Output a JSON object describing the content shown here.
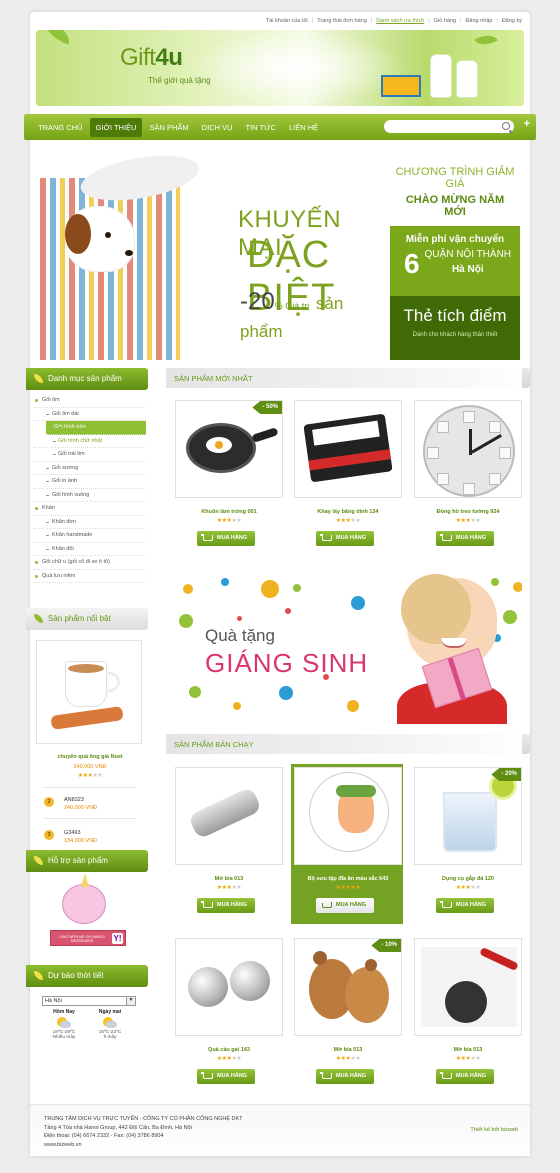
{
  "top_links": [
    "Tài khoản của tôi",
    "Trạng thái đơn hàng",
    "Danh sách ưa thích",
    "Giỏ hàng",
    "Đăng nhập",
    "Đăng ký"
  ],
  "top_links_active_index": 2,
  "logo": {
    "text_main": "Gift",
    "text_bold": "4u",
    "tagline": "Thế giới quà tặng"
  },
  "nav": {
    "items": [
      "TRANG CHỦ",
      "GIỚI THIỆU",
      "SẢN PHẨM",
      "DỊCH VỤ",
      "TIN TỨC",
      "LIÊN HỆ"
    ],
    "active_index": 1,
    "search_placeholder": ""
  },
  "banner": {
    "line1": "KHUYẾN MẠI",
    "line2": "ĐẶC BIỆT",
    "discount": "-20",
    "percent": "%",
    "discount_note": "Giá trị",
    "discount_note2": "sản",
    "discount_note3": "phẩm",
    "right1_line1": "CHƯƠNG TRÌNH GIẢM GIÁ",
    "right1_line2": "CHÀO MỪNG NĂM MỚI",
    "right2_line1": "Miễn phí vận chuyển",
    "right2_six": "6",
    "right2_line2": "QUẬN NỘI THÀNH",
    "right2_line3": "Hà Nội",
    "right3_line1": "Thẻ tích điểm",
    "right3_line2": "Dành cho khách hàng thân thiết"
  },
  "sidebar": {
    "categories_title": "Danh mục sản phẩm",
    "categories": [
      {
        "label": "Gối ôm",
        "level": 0
      },
      {
        "label": "Gối ôm dài",
        "level": 1
      },
      {
        "label": "Gối hình tròn",
        "level": 1,
        "highlight": true
      },
      {
        "label": "Gối hình chữ nhật",
        "level": 2,
        "sub": true
      },
      {
        "label": "Gối trái tim",
        "level": 2
      },
      {
        "label": "Gối sương",
        "level": 1
      },
      {
        "label": "Gối in ảnh",
        "level": 1
      },
      {
        "label": "Gối hình vuông",
        "level": 1
      },
      {
        "label": "Khăn",
        "level": 0
      },
      {
        "label": "Khăn đơn",
        "level": 1
      },
      {
        "label": "Khăn handmade",
        "level": 1
      },
      {
        "label": "Khăn đôi",
        "level": 1
      },
      {
        "label": "Gối chữ u (gối cổ đi xe ô tô)",
        "level": 0
      },
      {
        "label": "Quà lưu niệm",
        "level": 0
      }
    ],
    "featured_title": "Sản phẩm nổi bật",
    "featured": {
      "name": "chuyên quà ông già Noel",
      "price": "340.000 VNĐ",
      "stars": 3
    },
    "mini_products": [
      {
        "rank": "2",
        "name": "AN8323",
        "price": "240.000 VNĐ"
      },
      {
        "rank": "3",
        "name": "G3493",
        "price": "134.000 VNĐ"
      }
    ],
    "support_title": "Hỗ trợ sản phẩm",
    "support_chat": "CHAT WITH ME ON YAHOO! MESSENGER",
    "support_y": "Y!",
    "weather_title": "Dự báo thời tiết",
    "weather_city": "Hà Nội",
    "weather": [
      {
        "day": "Hôm Nay",
        "temp": "18ºC-29ºC",
        "desc": "Nhiều mây"
      },
      {
        "day": "Ngày mai",
        "temp": "15ºC-22ºC",
        "desc": "Ít mây"
      }
    ]
  },
  "new_products": {
    "title": "SẢN PHẨM MỚI NHẤT",
    "items": [
      {
        "name": "Khuôn làm trứng 001",
        "stars": 3,
        "discount": "- 50%"
      },
      {
        "name": "Khay lấy băng dính 134",
        "stars": 3,
        "discount": ""
      },
      {
        "name": "Đồng hồ treo tường 924",
        "stars": 3,
        "discount": ""
      }
    ]
  },
  "xmas_banner": {
    "line1": "Quà tặng",
    "line2": "GIÁNG SINH"
  },
  "best_sellers": {
    "title": "SẢN PHẨM BÁN CHẠY",
    "items": [
      {
        "name": "Mở bia 013",
        "stars": 3,
        "discount": ""
      },
      {
        "name": "Bộ sưu tập đĩa ăn màu sắc 643",
        "stars": 5,
        "discount": ""
      },
      {
        "name": "Dụng cụ gắp đá 120",
        "stars": 3,
        "discount": "- 20%"
      },
      {
        "name": "Quả cầu gai 143",
        "stars": 3,
        "discount": ""
      },
      {
        "name": "Mở bia 013",
        "stars": 3,
        "discount": "- 10%"
      },
      {
        "name": "Mở bia 013",
        "stars": 3,
        "discount": ""
      }
    ]
  },
  "buy_label": "MUA HÀNG",
  "footer": {
    "line1": "TRUNG TÂM DỊCH VỤ TRỰC TUYẾN - CÔNG TY CỔ PHẦN CÔNG NGHỆ DKT",
    "line2": "Tầng 4 Tòa nhà Hanoi Group, 442 Đội Cấn, Ba Đình, Hà Nội",
    "line3": "Điện thoại: (04) 6674 2332 - Fax: (04) 3786 8904",
    "line4": "www.bizweb.vn",
    "credit": "Thiết kế bởi bizweb"
  },
  "colors": {
    "brand_green": "#76a314",
    "dark_green": "#3f6a06",
    "price_orange": "#e88a00",
    "star": "#f0a500"
  }
}
